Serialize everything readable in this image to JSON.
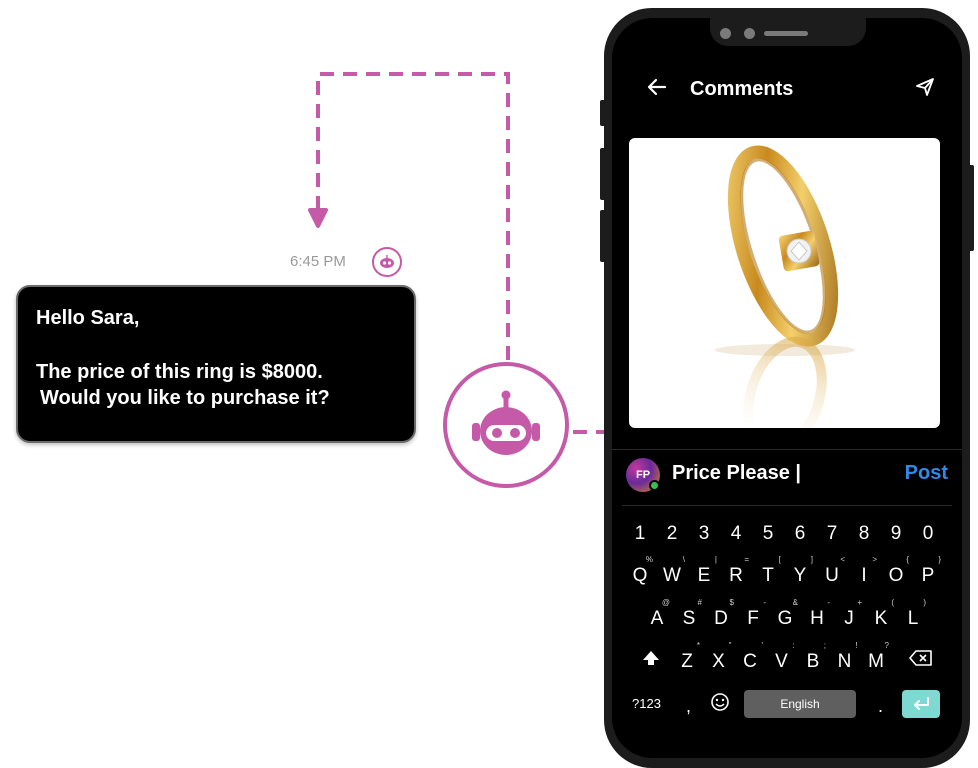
{
  "chat": {
    "timestamp": "6:45 PM",
    "message_line1": "Hello Sara,",
    "message_line2": "The price of this ring is $8000.",
    "message_line3": "Would you like to purchase it?"
  },
  "phone": {
    "header_title": "Comments",
    "icons": {
      "back": "arrow-left-icon",
      "send": "send-icon",
      "bot": "robot-icon"
    },
    "comment": {
      "avatar_initials": "FP",
      "input_text": "Price Please |",
      "post_label": "Post"
    },
    "keyboard": {
      "numbers": [
        "1",
        "2",
        "3",
        "4",
        "5",
        "6",
        "7",
        "8",
        "9",
        "0"
      ],
      "row1": [
        "Q",
        "W",
        "E",
        "R",
        "T",
        "Y",
        "U",
        "I",
        "O",
        "P"
      ],
      "row1_alt": [
        "%",
        "\\",
        "|",
        "=",
        "[",
        "]",
        "<",
        ">",
        "{",
        "}"
      ],
      "row2": [
        "A",
        "S",
        "D",
        "F",
        "G",
        "H",
        "J",
        "K",
        "L"
      ],
      "row2_alt": [
        "@",
        "#",
        "$",
        "-",
        "&",
        "-",
        "+",
        "(",
        ")"
      ],
      "row3": [
        "Z",
        "X",
        "C",
        "V",
        "B",
        "N",
        "M"
      ],
      "row3_alt": [
        "*",
        "\"",
        "'",
        ":",
        ";",
        "!",
        "?"
      ],
      "symbols_key": "?123",
      "comma_key": ",",
      "space_label": "English",
      "period_key": "."
    }
  },
  "colors": {
    "accent": "#c45aa8",
    "post_blue": "#2d8ae6",
    "enter_key": "#7fd9d3",
    "online_green": "#33c24d"
  }
}
